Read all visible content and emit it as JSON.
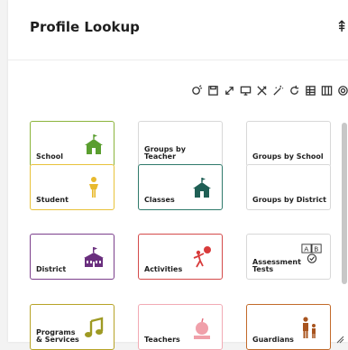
{
  "header": {
    "title": "Profile Lookup"
  },
  "toolbar": {
    "buttons": [
      "wand-refresh-icon",
      "save-icon",
      "expand-icon",
      "monitor-icon",
      "tools-icon",
      "magic-wand-icon",
      "refresh-icon",
      "table-icon",
      "columns-icon",
      "gear-icon"
    ]
  },
  "tiles": [
    {
      "label": "School",
      "border": "#8cb43c",
      "icon": "school-house-icon",
      "icon_color": "#5a9e2f"
    },
    {
      "label": "Groups by\nTeacher",
      "border": "#d8d8d8",
      "icon": "",
      "icon_color": ""
    },
    {
      "label": "Groups by School",
      "border": "#d8d8d8",
      "icon": "",
      "icon_color": ""
    },
    {
      "label": "Student",
      "border": "#e8c23a",
      "icon": "student-icon",
      "icon_color": "#e8b92d"
    },
    {
      "label": "Classes",
      "border": "#2f7a6b",
      "icon": "classroom-icon",
      "icon_color": "#1f5f55"
    },
    {
      "label": "Groups by District",
      "border": "#d8d8d8",
      "icon": "",
      "icon_color": ""
    },
    {
      "label": "District",
      "border": "#7b3f8c",
      "icon": "district-building-icon",
      "icon_color": "#6a2f7e"
    },
    {
      "label": "Activities",
      "border": "#d44a4a",
      "icon": "activities-ball-icon",
      "icon_color": "#d83b3b"
    },
    {
      "label": "Assessment\nTests",
      "border": "#d8d8d8",
      "icon": "assessment-ab-icon",
      "icon_color": "#333333"
    },
    {
      "label": "Programs\n& Services",
      "border": "#b7a326",
      "icon": "music-note-icon",
      "icon_color": "#9e9a23"
    },
    {
      "label": "Teachers",
      "border": "#f2aab4",
      "icon": "teacher-apple-icon",
      "icon_color": "#e46a7a"
    },
    {
      "label": "Guardians",
      "border": "#c26a2a",
      "icon": "guardian-family-icon",
      "icon_color": "#a8541e"
    }
  ]
}
